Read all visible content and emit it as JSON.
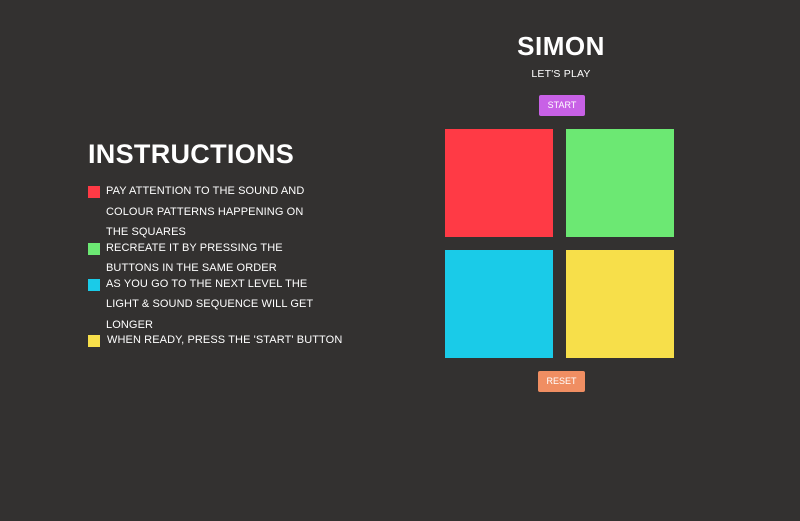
{
  "colors": {
    "red": "#ff3a45",
    "green": "#6ce873",
    "blue": "#1acbe8",
    "yellow": "#f7df4a",
    "start_button": "#c861e6",
    "reset_button": "#f08e62",
    "background": "#333130"
  },
  "instructions": {
    "heading": "INSTRUCTIONS",
    "items": [
      {
        "color": "red",
        "text": "PAY ATTENTION TO THE SOUND AND COLOUR PATTERNS HAPPENING ON THE SQUARES"
      },
      {
        "color": "green",
        "text": "RECREATE IT BY PRESSING THE BUTTONS IN THE SAME ORDER"
      },
      {
        "color": "blue",
        "text": "AS YOU GO TO THE NEXT LEVEL THE LIGHT & SOUND SEQUENCE WILL GET LONGER"
      },
      {
        "color": "yellow",
        "text": "WHEN READY, PRESS THE 'START' BUTTON"
      }
    ]
  },
  "game": {
    "title": "SIMON",
    "subtitle": "LET'S PLAY",
    "start_label": "START",
    "reset_label": "RESET",
    "pads": [
      "red",
      "green",
      "blue",
      "yellow"
    ]
  }
}
